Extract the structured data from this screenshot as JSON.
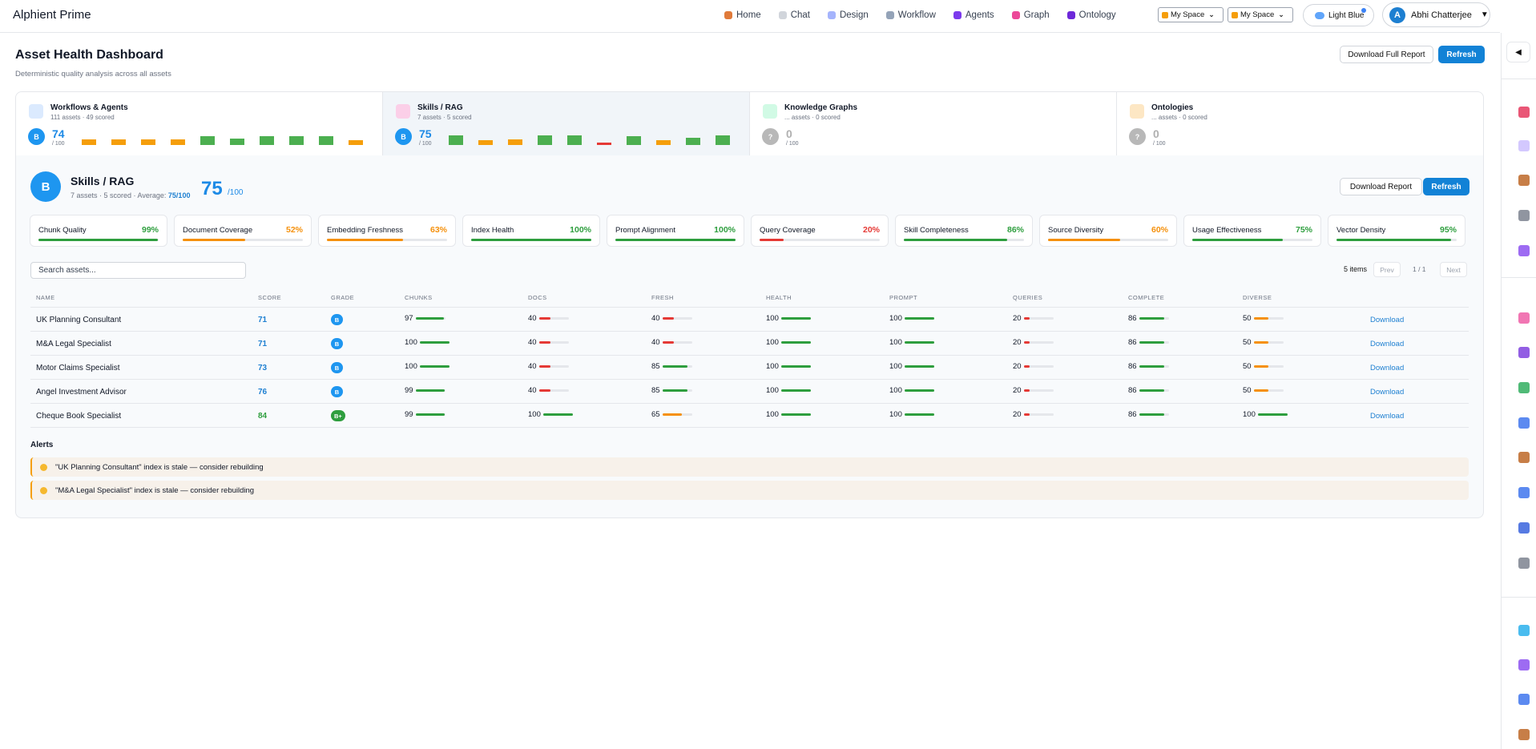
{
  "app": {
    "brand": "Alphient Prime"
  },
  "nav": [
    {
      "label": "Home",
      "icon": "home-icon",
      "color": "#e07a3a"
    },
    {
      "label": "Chat",
      "icon": "chat-icon",
      "color": "#d1d5db"
    },
    {
      "label": "Design",
      "icon": "design-icon",
      "color": "#a5b4fc"
    },
    {
      "label": "Workflow",
      "icon": "workflow-icon",
      "color": "#94a3b8"
    },
    {
      "label": "Agents",
      "icon": "agents-icon",
      "color": "#7c3aed"
    },
    {
      "label": "Graph",
      "icon": "graph-icon",
      "color": "#ec4899"
    },
    {
      "label": "Ontology",
      "icon": "ontology-icon",
      "color": "#6d28d9"
    }
  ],
  "space_selects": [
    {
      "value": "My Space"
    },
    {
      "value": "My Space"
    }
  ],
  "theme": {
    "label": "Light Blue"
  },
  "user": {
    "initial": "A",
    "name": "Abhi Chatterjee"
  },
  "header": {
    "title": "Asset Health Dashboard",
    "subtitle": "Deterministic quality analysis across all assets",
    "download_full": "Download Full Report",
    "refresh": "Refresh"
  },
  "categories": [
    {
      "title": "Workflows & Agents",
      "meta": "111 assets · 49 scored",
      "grade": "B",
      "score": "74",
      "denom": "/ 100",
      "grade_color": "#1e96f0",
      "score_color": "#1d8ae6",
      "icon_color": "#dbeafe",
      "spark": [
        {
          "c": "#f59e0b",
          "h": 0.5
        },
        {
          "c": "#f59e0b",
          "h": 0.5
        },
        {
          "c": "#f59e0b",
          "h": 0.5
        },
        {
          "c": "#f59e0b",
          "h": 0.5
        },
        {
          "c": "#4caf50",
          "h": 0.75
        },
        {
          "c": "#4caf50",
          "h": 0.6
        },
        {
          "c": "#4caf50",
          "h": 0.75
        },
        {
          "c": "#4caf50",
          "h": 0.75
        },
        {
          "c": "#4caf50",
          "h": 0.75
        },
        {
          "c": "#f59e0b",
          "h": 0.45
        }
      ]
    },
    {
      "title": "Skills / RAG",
      "meta": "7 assets · 5 scored",
      "grade": "B",
      "score": "75",
      "denom": "/ 100",
      "grade_color": "#1e96f0",
      "score_color": "#1d8ae6",
      "icon_color": "#fbcfe8",
      "active": true,
      "spark": [
        {
          "c": "#4caf50",
          "h": 0.85
        },
        {
          "c": "#f59e0b",
          "h": 0.45
        },
        {
          "c": "#f59e0b",
          "h": 0.5
        },
        {
          "c": "#4caf50",
          "h": 0.85
        },
        {
          "c": "#4caf50",
          "h": 0.85
        },
        {
          "c": "#e53935",
          "h": 0.2
        },
        {
          "c": "#4caf50",
          "h": 0.8
        },
        {
          "c": "#f59e0b",
          "h": 0.45
        },
        {
          "c": "#4caf50",
          "h": 0.65
        },
        {
          "c": "#4caf50",
          "h": 0.85
        }
      ]
    },
    {
      "title": "Knowledge Graphs",
      "meta": "... assets · 0 scored",
      "grade": "?",
      "score": "0",
      "denom": "/ 100",
      "grade_color": "#b8b8b8",
      "score_color": "#b0b0b0",
      "icon_color": "#d1fae5",
      "spark": []
    },
    {
      "title": "Ontologies",
      "meta": "... assets · 0 scored",
      "grade": "?",
      "score": "0",
      "denom": "/ 100",
      "grade_color": "#b8b8b8",
      "score_color": "#b0b0b0",
      "icon_color": "#fde7c4",
      "spark": []
    }
  ],
  "section": {
    "grade": "B",
    "title": "Skills / RAG",
    "meta_prefix": "7 assets · 5 scored · Average:",
    "average": "75/100",
    "score": "75",
    "denom": "/100",
    "download": "Download Report",
    "refresh": "Refresh"
  },
  "metrics": [
    {
      "label": "Chunk Quality",
      "value": "99%",
      "pct": 99,
      "color": "#2e9e3e"
    },
    {
      "label": "Document Coverage",
      "value": "52%",
      "pct": 52,
      "color": "#f5900b"
    },
    {
      "label": "Embedding Freshness",
      "value": "63%",
      "pct": 63,
      "color": "#f5900b"
    },
    {
      "label": "Index Health",
      "value": "100%",
      "pct": 100,
      "color": "#2e9e3e"
    },
    {
      "label": "Prompt Alignment",
      "value": "100%",
      "pct": 100,
      "color": "#2e9e3e"
    },
    {
      "label": "Query Coverage",
      "value": "20%",
      "pct": 20,
      "color": "#e53935"
    },
    {
      "label": "Skill Completeness",
      "value": "86%",
      "pct": 86,
      "color": "#2e9e3e"
    },
    {
      "label": "Source Diversity",
      "value": "60%",
      "pct": 60,
      "color": "#f5900b"
    },
    {
      "label": "Usage Effectiveness",
      "value": "75%",
      "pct": 75,
      "color": "#2e9e3e"
    },
    {
      "label": "Vector Density",
      "value": "95%",
      "pct": 95,
      "color": "#2e9e3e"
    }
  ],
  "search": {
    "placeholder": "Search assets..."
  },
  "pagination": {
    "count": "5 items",
    "prev": "Prev",
    "info": "1 / 1",
    "next": "Next"
  },
  "table": {
    "headers": [
      "NAME",
      "SCORE",
      "GRADE",
      "CHUNKS",
      "DOCS",
      "FRESH",
      "HEALTH",
      "PROMPT",
      "QUERIES",
      "COMPLETE",
      "DIVERSE"
    ],
    "download_label": "Download",
    "rows": [
      {
        "name": "UK Planning Consultant",
        "score": "71",
        "score_color": "#1d7fd1",
        "grade": "B",
        "grade_color": "#1e96f0",
        "metrics": [
          97,
          40,
          40,
          100,
          100,
          20,
          86,
          50
        ]
      },
      {
        "name": "M&A Legal Specialist",
        "score": "71",
        "score_color": "#1d7fd1",
        "grade": "B",
        "grade_color": "#1e96f0",
        "metrics": [
          100,
          40,
          40,
          100,
          100,
          20,
          86,
          50
        ]
      },
      {
        "name": "Motor Claims Specialist",
        "score": "73",
        "score_color": "#1d7fd1",
        "grade": "B",
        "grade_color": "#1e96f0",
        "metrics": [
          100,
          40,
          85,
          100,
          100,
          20,
          86,
          50
        ]
      },
      {
        "name": "Angel Investment Advisor",
        "score": "76",
        "score_color": "#1d7fd1",
        "grade": "B",
        "grade_color": "#1e96f0",
        "metrics": [
          99,
          40,
          85,
          100,
          100,
          20,
          86,
          50
        ]
      },
      {
        "name": "Cheque Book Specialist",
        "score": "84",
        "score_color": "#2e9e3e",
        "grade": "B+",
        "grade_color": "#2e9e3e",
        "metrics": [
          99,
          100,
          65,
          100,
          100,
          20,
          86,
          100
        ]
      }
    ]
  },
  "alerts": {
    "title": "Alerts",
    "items": [
      "\"UK Planning Consultant\" index is stale — consider rebuilding",
      "\"M&A Legal Specialist\" index is stale — consider rebuilding"
    ]
  },
  "rail_icons": [
    {
      "name": "target-icon",
      "color": "#e11d48"
    },
    {
      "name": "document-icon",
      "color": "#c4b5fd"
    },
    {
      "name": "clipboard-icon",
      "color": "#b45309"
    },
    {
      "name": "gear-icon",
      "color": "#6b7280"
    },
    {
      "name": "robot-icon",
      "color": "#7c3aed"
    },
    {
      "name": "brain-icon",
      "color": "#ec4899"
    },
    {
      "name": "mask-icon",
      "color": "#6d28d9"
    },
    {
      "name": "books-icon",
      "color": "#16a34a"
    },
    {
      "name": "book-icon",
      "color": "#2563eb"
    },
    {
      "name": "notes-icon",
      "color": "#b45309"
    },
    {
      "name": "shield-icon",
      "color": "#2563eb"
    },
    {
      "name": "briefcase-icon",
      "color": "#1d4ed8"
    },
    {
      "name": "tools-icon",
      "color": "#6b7280"
    },
    {
      "name": "globe-icon",
      "color": "#0ea5e9"
    },
    {
      "name": "save-icon",
      "color": "#7c3aed"
    },
    {
      "name": "chart-icon",
      "color": "#2563eb"
    },
    {
      "name": "scales-icon",
      "color": "#b45309"
    }
  ]
}
